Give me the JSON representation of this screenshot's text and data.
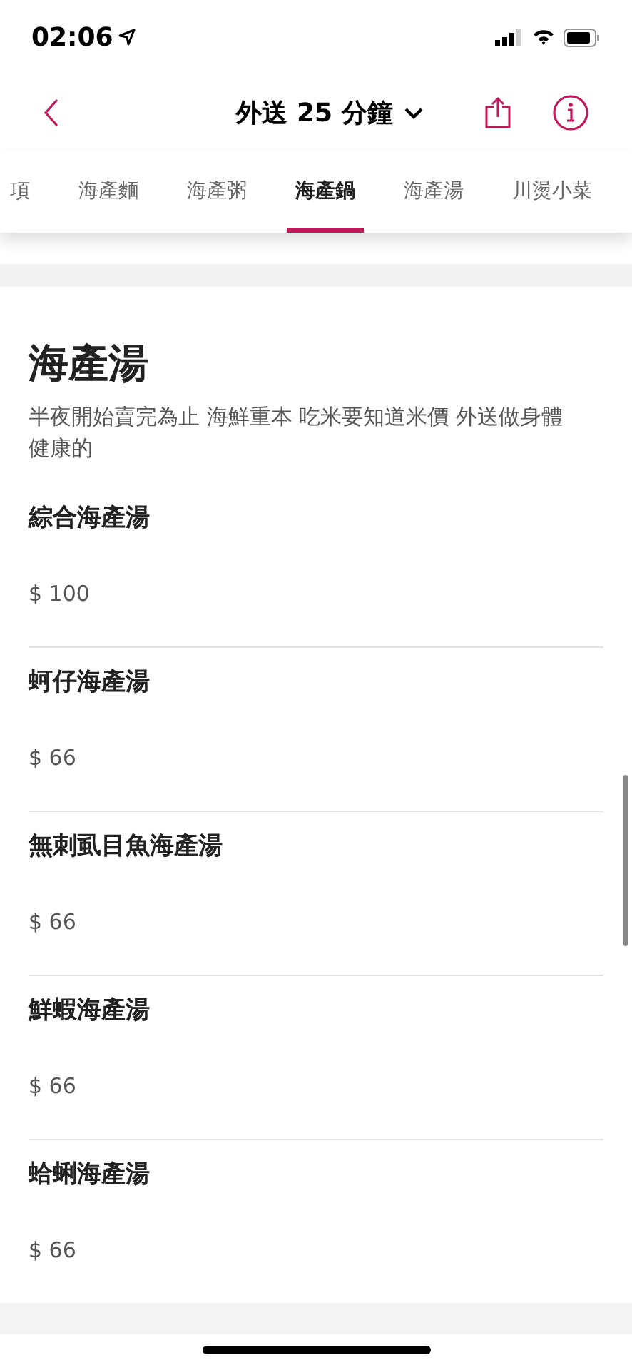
{
  "status_bar": {
    "time": "02:06"
  },
  "nav": {
    "title": "外送 25 分鐘"
  },
  "tabs": [
    {
      "label": "項",
      "selected": false
    },
    {
      "label": "海產麵",
      "selected": false
    },
    {
      "label": "海產粥",
      "selected": false
    },
    {
      "label": "海產鍋",
      "selected": true
    },
    {
      "label": "海產湯",
      "selected": false
    },
    {
      "label": "川燙小菜",
      "selected": false
    }
  ],
  "section": {
    "title": "海產湯",
    "description": "半夜開始賣完為止 海鮮重本 吃米要知道米價 外送做身體健康的",
    "items": [
      {
        "name": "綜合海產湯",
        "price": "$ 100"
      },
      {
        "name": "蚵仔海產湯",
        "price": "$ 66"
      },
      {
        "name": "無刺虱目魚海產湯",
        "price": "$ 66"
      },
      {
        "name": "鮮蝦海產湯",
        "price": "$ 66"
      },
      {
        "name": "蛤蜊海產湯",
        "price": "$ 66"
      }
    ]
  }
}
